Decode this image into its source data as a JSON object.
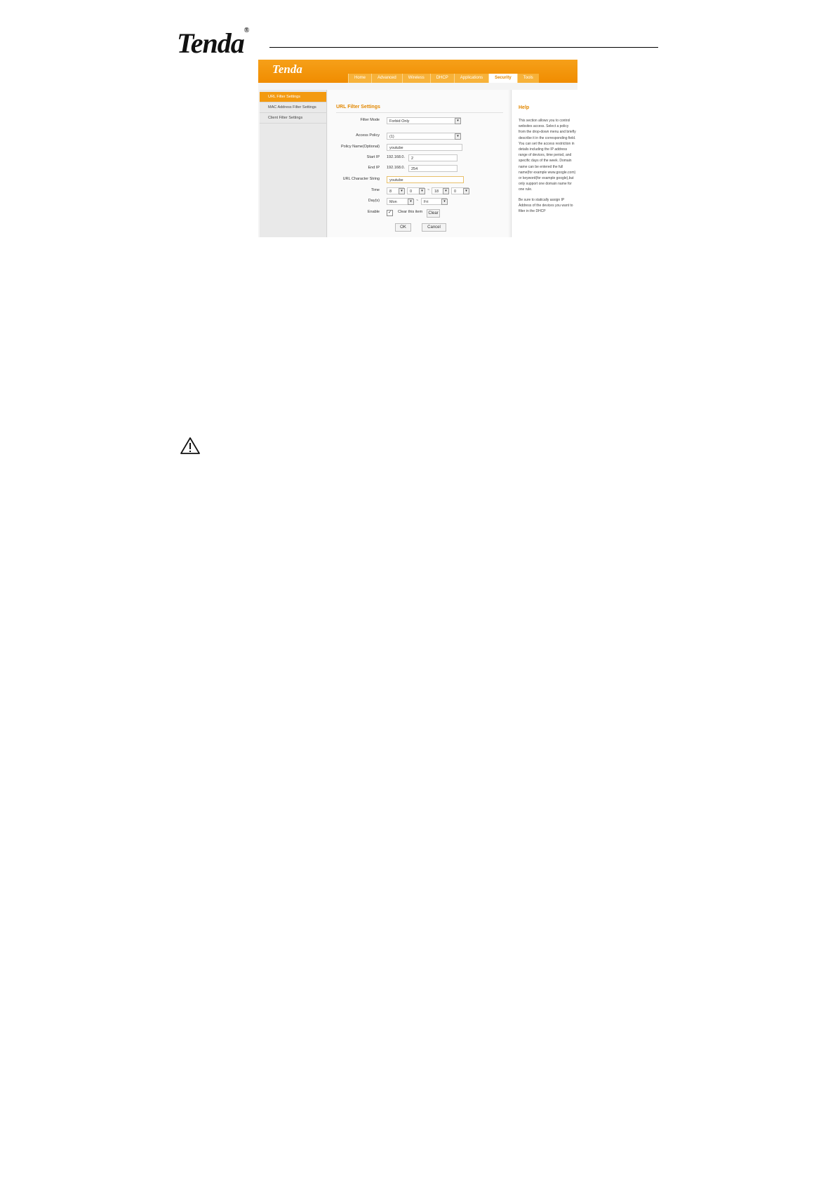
{
  "doc": {
    "logo": "Tenda",
    "logo_mark": "®"
  },
  "app": {
    "logo": "Tenda",
    "nav": [
      "Home",
      "Advanced",
      "Wireless",
      "DHCP",
      "Applications",
      "Security",
      "Tools"
    ],
    "active_nav": "Security",
    "sidebar": [
      "URL Filter Settings",
      "MAC Address Filter Settings",
      "Client Filter Settings"
    ],
    "form": {
      "title": "URL Filter Settings",
      "filter_mode_label": "Filter Mode",
      "filter_mode_value": "Forbid Only",
      "access_policy_label": "Access Policy",
      "access_policy_value": "(1)",
      "policy_name_label": "Policy Name(Optional)",
      "policy_name_value": "youtube",
      "start_ip_label": "Start IP",
      "start_ip_prefix": "192.168.0.",
      "start_ip_value": "2",
      "end_ip_label": "End IP",
      "end_ip_prefix": "192.168.0.",
      "end_ip_value": "254",
      "url_label": "URL Character String",
      "url_value": "youtube",
      "time_label": "Time",
      "time_h1": "8",
      "time_m1": "0",
      "time_sep": "~",
      "time_h2": "18",
      "time_m2": "0",
      "days_label": "Day(s)",
      "day_from": "Mon",
      "day_sep": "~",
      "day_to": "Fri",
      "enable_label": "Enable",
      "clear_label": "Clear this item",
      "clear_button": "Clear",
      "ok_button": "OK",
      "cancel_button": "Cancel"
    },
    "help": {
      "title": "Help",
      "p1": "This section allows you to control websites access. Select a policy from the drop-down menu and briefly describe it in the corresponding field. You can set the access restriction in details including the IP address range of devices, time period, and specific days of the week. Domain name can be entered the full name(for example www.google.com) or keyword(for example google),but only support one domain name for one rule.",
      "p2": "Be sure to statically assign IP Address of the devices you want to filter in the DHCP"
    }
  }
}
